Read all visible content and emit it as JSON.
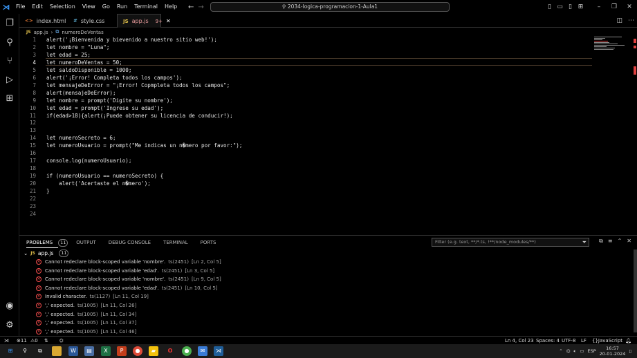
{
  "titlebar": {
    "menu": [
      "File",
      "Edit",
      "Selection",
      "View",
      "Go",
      "Run",
      "Terminal",
      "Help"
    ],
    "search_text": "2034-logica-programacion-1-Aula1",
    "logo_icon": "vscode-logo-icon"
  },
  "tabs": [
    {
      "icon": "<>",
      "label": "index.html"
    },
    {
      "icon": "#",
      "label": "style.css"
    },
    {
      "icon": "JS",
      "label": "app.js",
      "badge": "9+"
    }
  ],
  "breadcrumb": {
    "file": "app.js",
    "symbol": "numeroDeVentas"
  },
  "editor": {
    "current_line": 4,
    "lines": [
      "alert('¡Bienvenida y bievenido a nuestro sitio web!');",
      "let nombre = \"Luna\";",
      "let edad = 25;",
      "let numeroDeVentas = 50;",
      "let saldoDisponible = 1000;",
      "alert('¡Error! Completa todos los campos');",
      "let mensajeDeError = \"¡Error! Copmpleta todos los campos\";",
      "alert(mensajeDeError);",
      "let nombre = prompt('Digite su nombre');",
      "let edad = prompt('Ingrese su edad');",
      "if(edad>18){alert(¡Puede obtener su licencia de conducir!);",
      "",
      "",
      "let numeroSecreto = 6;",
      "let numeroUsuario = prompt(\"Me indicas un n�mero por favor:\");",
      "",
      "console.log(numeroUsuario);",
      "",
      "if (numeroUsuario == numeroSecreto) {",
      "    alert('Acertaste el n�mero');",
      "}",
      "",
      "",
      ""
    ]
  },
  "panel": {
    "tabs": [
      "PROBLEMS",
      "OUTPUT",
      "DEBUG CONSOLE",
      "TERMINAL",
      "PORTS"
    ],
    "problems_count": "11",
    "filter_placeholder": "Filter (e.g. text, **/*.ts, !**/node_modules/**)",
    "group": {
      "icon": "JS",
      "file": "app.js",
      "count": "11"
    },
    "problems": [
      {
        "msg": "Cannot redeclare block-scoped variable 'nombre'.",
        "code": "ts(2451)",
        "loc": "[Ln 2, Col 5]"
      },
      {
        "msg": "Cannot redeclare block-scoped variable 'edad'.",
        "code": "ts(2451)",
        "loc": "[Ln 3, Col 5]"
      },
      {
        "msg": "Cannot redeclare block-scoped variable 'nombre'.",
        "code": "ts(2451)",
        "loc": "[Ln 9, Col 5]"
      },
      {
        "msg": "Cannot redeclare block-scoped variable 'edad'.",
        "code": "ts(2451)",
        "loc": "[Ln 10, Col 5]"
      },
      {
        "msg": "Invalid character.",
        "code": "ts(1127)",
        "loc": "[Ln 11, Col 19]"
      },
      {
        "msg": "',' expected.",
        "code": "ts(1005)",
        "loc": "[Ln 11, Col 26]"
      },
      {
        "msg": "',' expected.",
        "code": "ts(1005)",
        "loc": "[Ln 11, Col 34]"
      },
      {
        "msg": "',' expected.",
        "code": "ts(1005)",
        "loc": "[Ln 11, Col 37]"
      },
      {
        "msg": "',' expected.",
        "code": "ts(1005)",
        "loc": "[Ln 11, Col 46]"
      }
    ]
  },
  "status": {
    "errors": "11",
    "warnings": "0",
    "position": "Ln 4, Col 23",
    "spaces": "Spaces: 4",
    "encoding": "UTF-8",
    "eol": "LF",
    "language": "JavaScript"
  },
  "taskbar": {
    "lang": "ESP",
    "time": "16:57",
    "date": "20-01-2024"
  },
  "colors": {
    "error": "#f14c4c",
    "js_badge": "#e2c04a",
    "accent": "#3b9cff"
  }
}
